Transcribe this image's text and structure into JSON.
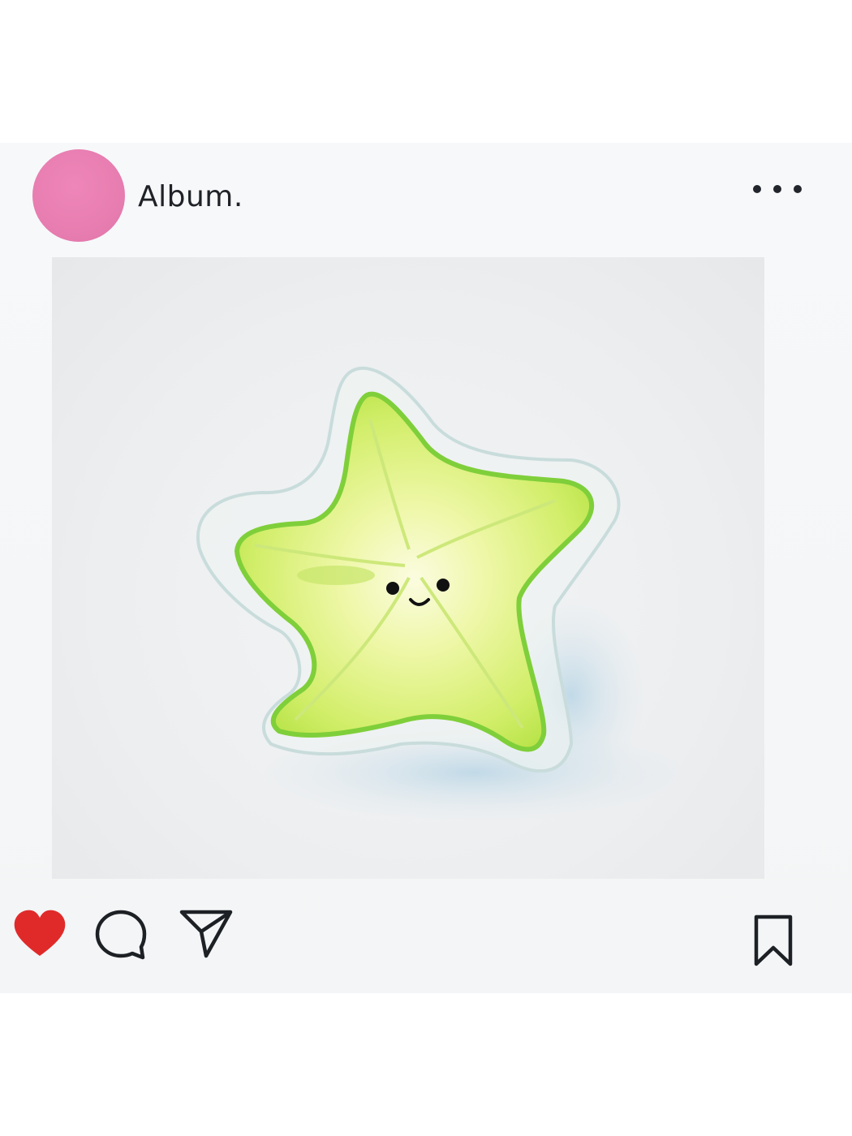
{
  "post": {
    "username": "Album.",
    "avatar_color": "#e87fb2",
    "liked": true,
    "like_color": "#e02a2a"
  },
  "icons": {
    "more": "more-dots-icon",
    "like": "heart-icon",
    "comment": "comment-bubble-icon",
    "share": "send-paper-plane-icon",
    "save": "bookmark-icon"
  }
}
